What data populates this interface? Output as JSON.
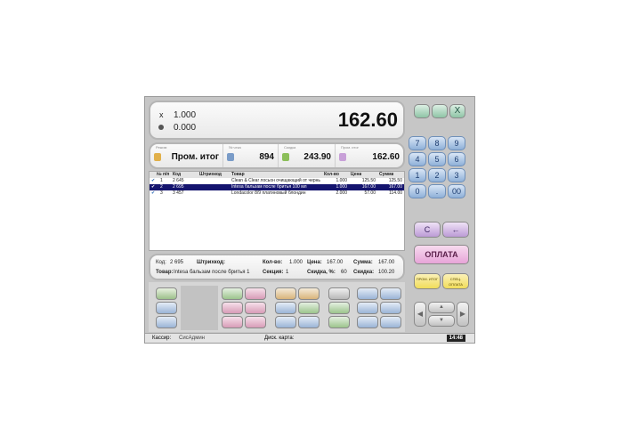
{
  "display": {
    "quantity_sign": "x",
    "quantity": "1.000",
    "discount": "0.000",
    "total": "162.60"
  },
  "summary": {
    "mode_caption": "Режим",
    "mode_value": "Пром. итог",
    "check_caption": "№ чека",
    "check_value": "894",
    "discount_caption": "Скидка",
    "discount_value": "243.90",
    "subtotal_caption": "Пром. итог",
    "subtotal_value": "162.60"
  },
  "table": {
    "headers": [
      "№ п/п",
      "Код",
      "Штрихкод",
      "Товар",
      "Кол-во",
      "Цена",
      "Сумма"
    ],
    "rows": [
      {
        "num": "1",
        "code": "2 645",
        "barcode": "",
        "name": "Clean & Clear лосьон очищающий от черны...",
        "qty": "1.000",
        "price": "125.50",
        "sum": "125.50"
      },
      {
        "num": "2",
        "code": "2 695",
        "barcode": "",
        "name": "Intesa бальзам после бритья 100 мл",
        "qty": "1.000",
        "price": "167.00",
        "sum": "167.00"
      },
      {
        "num": "3",
        "code": "3 457",
        "barcode": "",
        "name": "Londacolor 8/9 платиновый блондин",
        "qty": "2.000",
        "price": "57.00",
        "sum": "114.00"
      }
    ]
  },
  "info": {
    "code_label": "Код:",
    "code_value": "2 695",
    "barcode_label": "Штрихкод:",
    "qty_label": "Кол-во:",
    "qty_value": "1.000",
    "price_label": "Цена:",
    "price_value": "167.00",
    "sum_label": "Сумма:",
    "sum_value": "167.00",
    "product_label": "Товар:",
    "product_value": "Intesa бальзам после бритья 1",
    "section_label": "Секция:",
    "section_value": "1",
    "discount_pct_label": "Скидка, %:",
    "discount_pct_value": "60",
    "discount_label": "Скидка:",
    "discount_value": "100.20"
  },
  "keypad": {
    "digits": [
      "7",
      "8",
      "9",
      "4",
      "5",
      "6",
      "1",
      "2",
      "3",
      "0",
      ".",
      "00"
    ],
    "clear_label": "C",
    "backspace_label": "←",
    "pay_label": "ОПЛАТА",
    "subtotal_label": "ПРОМ. ИТОГ",
    "special_pay_label": "СПЕЦ. ОПЛАТА",
    "close_label": "X"
  },
  "status": {
    "cashier_label": "Кассир:",
    "cashier_value": "СисАдмин",
    "card_label": "Диск. карта:",
    "time": "14:48"
  },
  "colors": {
    "selected_row": "#14146e",
    "pay_button": "#e7a4d8",
    "yellow_button": "#f1dd5a",
    "key_blue": "#9fbbe0"
  }
}
